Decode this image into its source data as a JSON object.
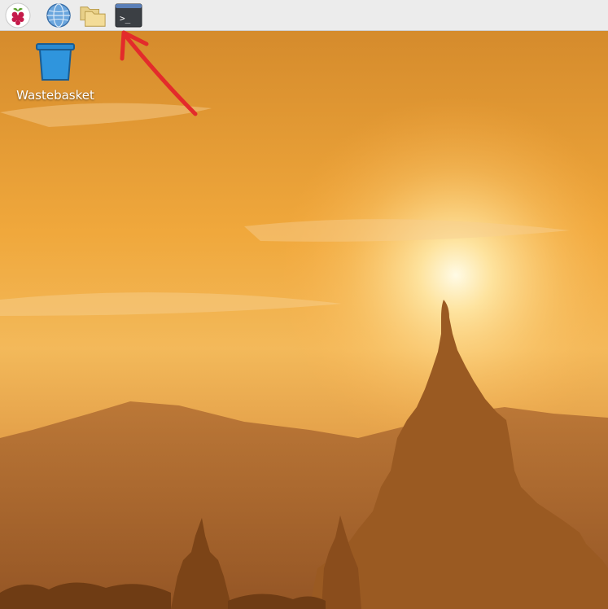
{
  "taskbar": {
    "launchers": [
      {
        "name": "raspberry-menu",
        "icon": "raspberry-pi-icon"
      },
      {
        "name": "web-browser",
        "icon": "globe-icon"
      },
      {
        "name": "file-manager",
        "icon": "folder-icon"
      },
      {
        "name": "terminal",
        "icon": "terminal-icon",
        "glyph": ">_"
      }
    ]
  },
  "desktop": {
    "icons": [
      {
        "label": "Wastebasket",
        "icon": "wastebasket-icon"
      }
    ]
  },
  "annotation": {
    "color": "#e32b2b",
    "target": "terminal"
  }
}
